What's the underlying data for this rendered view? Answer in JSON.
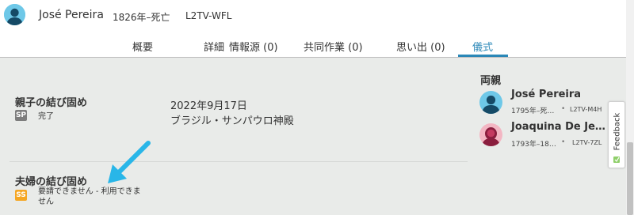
{
  "person": {
    "name": "José Pereira",
    "lifespan": "1826年–死亡",
    "pid": "L2TV-WFL"
  },
  "tabs": [
    "概要",
    "詳細",
    "情報源 (0)",
    "共同作業 (0)",
    "思い出 (0)",
    "儀式"
  ],
  "active_tab": "儀式",
  "ordinances": {
    "sealing_to_parents": {
      "title": "親子の結び固め",
      "badge": "SP",
      "status": "完了",
      "date": "2022年9月17日",
      "temple": "ブラジル・サンパウロ神殿"
    },
    "sealing_to_spouse": {
      "title": "夫婦の結び固め",
      "badge": "SS",
      "status": "要請できません - 利用できま",
      "status_line2": "せん"
    }
  },
  "parents": {
    "title": "両親",
    "father": {
      "name": "José Pereira",
      "lifespan": "1795年–死…",
      "pid": "L2TV-M4H"
    },
    "mother": {
      "name": "Joaquina De Je…",
      "lifespan": "1793年–18…",
      "pid": "L2TV-7ZL"
    }
  },
  "feedback": {
    "label": "Feedback"
  },
  "colors": {
    "accent_blue": "#2b88b8",
    "annotation_arrow": "#29b6e8",
    "badge_sp": "#7d7d7d",
    "badge_ss": "#f5a623",
    "content_bg": "#e9ebe9"
  }
}
